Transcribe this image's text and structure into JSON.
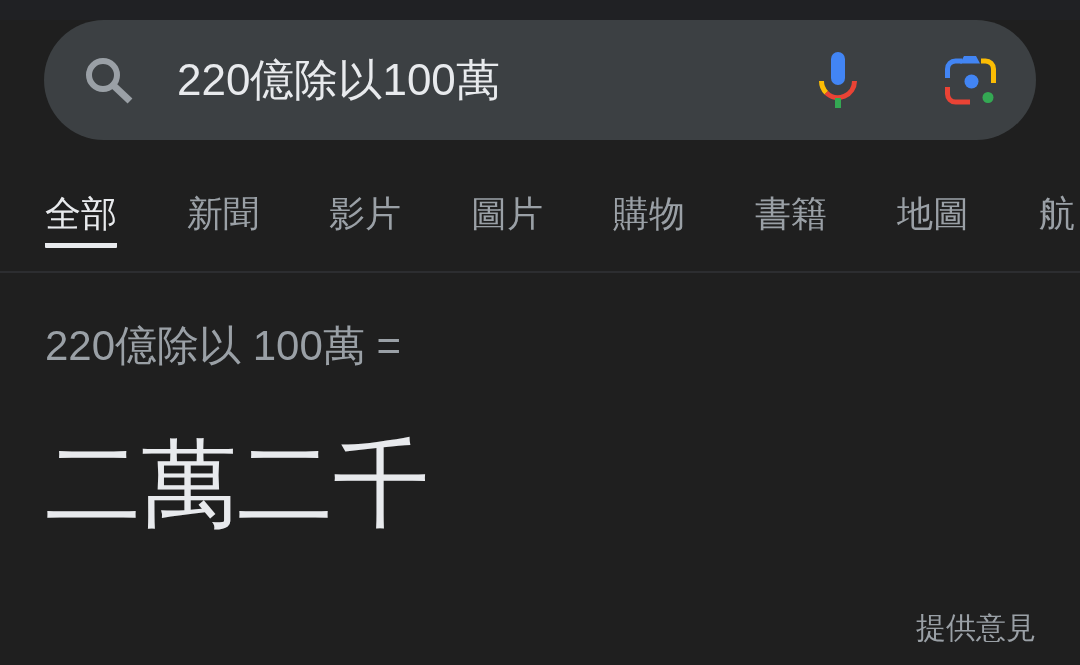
{
  "search": {
    "value": "220億除以100萬"
  },
  "tabs": [
    {
      "label": "全部",
      "selected": true
    },
    {
      "label": "新聞",
      "selected": false
    },
    {
      "label": "影片",
      "selected": false
    },
    {
      "label": "圖片",
      "selected": false
    },
    {
      "label": "購物",
      "selected": false
    },
    {
      "label": "書籍",
      "selected": false
    },
    {
      "label": "地圖",
      "selected": false
    },
    {
      "label": "航",
      "selected": false
    }
  ],
  "result": {
    "expression": "220億除以 100萬 =",
    "answer": "二萬二千"
  },
  "feedback_link": "提供意見"
}
